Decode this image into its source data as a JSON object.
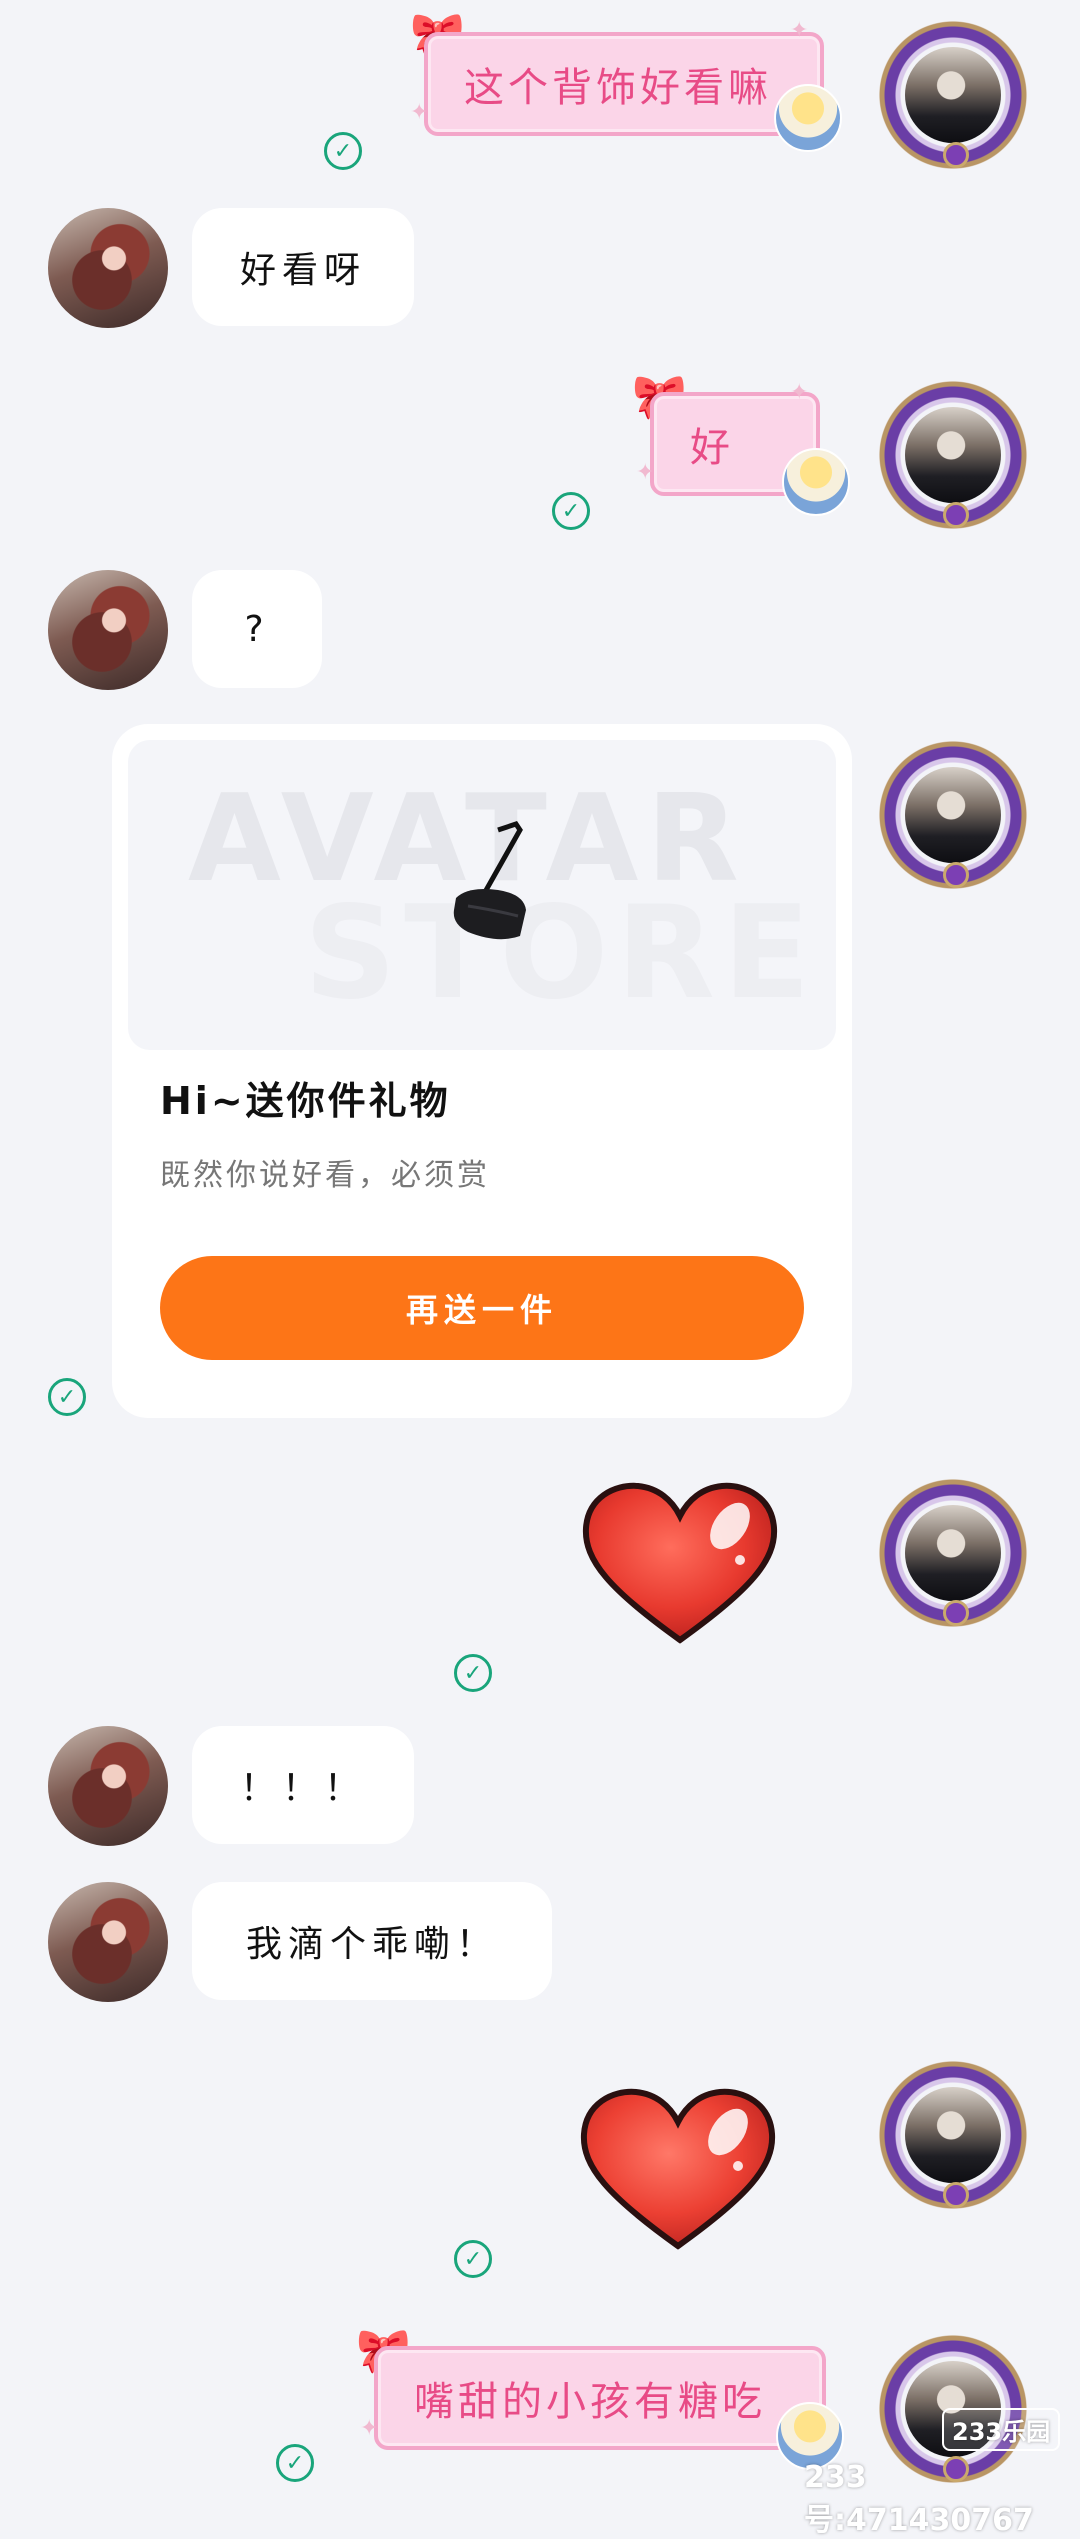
{
  "messages": {
    "m1": "这个背饰好看嘛",
    "m2": "好看呀",
    "m3": "好",
    "m4": "?",
    "m5": "！！！",
    "m6": "我滴个乖嘞！",
    "m7": "嘴甜的小孩有糖吃"
  },
  "gift_card": {
    "watermark_line1": "AVATAR",
    "watermark_line2": "STORE",
    "title": "Hi~送你件礼物",
    "subtitle": "既然你说好看，必须赏",
    "button_label": "再送一件"
  },
  "footer": {
    "site_logo": "233乐园",
    "user_id": "233号:471430767"
  },
  "icons": {
    "sent_check": "check-circle-icon",
    "heart_sticker": "heart-icon",
    "bow": "bow-icon"
  },
  "colors": {
    "background": "#f3f4f8",
    "pink_bubble": "#fbd5e8",
    "pink_text": "#e84b86",
    "check": "#19a57b",
    "button": "#fd7517"
  }
}
